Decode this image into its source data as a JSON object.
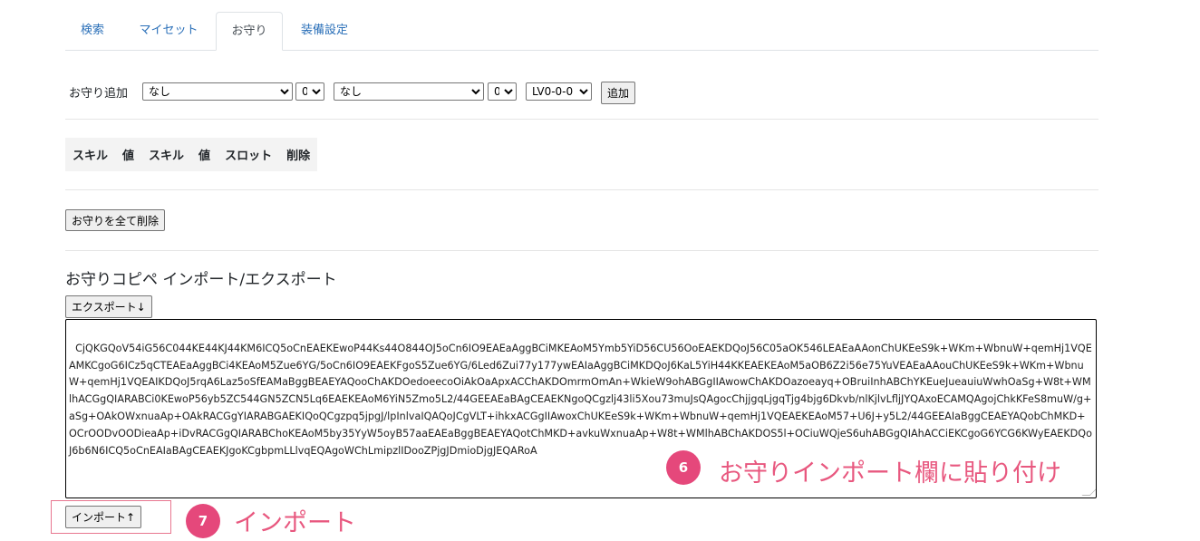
{
  "tabs": [
    {
      "label": "検索"
    },
    {
      "label": "マイセット"
    },
    {
      "label": "お守り"
    },
    {
      "label": "装備設定"
    }
  ],
  "add_row": {
    "label": "お守り追加",
    "skill1": "なし",
    "value1": "0",
    "skill2": "なし",
    "value2": "0",
    "slot": "LV0-0-0",
    "add_button": "追加"
  },
  "skill_table": {
    "headers": [
      "スキル",
      "値",
      "スキル",
      "値",
      "スロット",
      "削除"
    ]
  },
  "delete_all_button": "お守りを全て削除",
  "copy_section": {
    "title": "お守りコピペ インポート/エクスポート",
    "export_button": "エクスポート↓",
    "textarea_value": "CjQKGQoV54iG56C044KE44KJ44KM6ICQ5oCnEAEKEwoP44Ks44O844OJ5oCn6IO9EAEaAggBCiMKEAoM5Ymb5YiD56CU56OoEAEKDQoJ56C05aOK546LEAEaAAonChUKEeS9k+WKm+WbnuW+qemHj1VQEAMKCgoG6ICz5qCTEAEaAggBCi4KEAoM5Zue6YG/5oCn6IO9EAEKFgoS5Zue6YG/6Led6Zui77y177ywEAIaAggBCiMKDQoJ6KaL5YiH44KKEAEKEAoM5aOB6Z2i56e75YuVEAEaAAouChUKEeS9k+WKm+WbnuW+qemHj1VQEAIKDQoJ5rqA6Laz5oSfEAMaBggBEAEYAQooChAKDOedoeecoOiAkOaApxACChAKDOmrmOmAn+WkieW9ohABGgIIAwowChAKDOazoeayq+OBruiInhABChYKEueJueauiuWwhOaSg+W8t+WMlhACGgQIARABCi0KEwoP56yb5ZC544GN5ZCN5Lq6EAEKEAoM6YiN5Zmo5L2/44GEEAEaBAgCEAEKNgoQCgzlj43li5Xou73muJsQAgocChjjgqLjgqTjg4bjg6Dkvb/nlKjlvLfljJYQAxoECAMQAgojChkKFeS8muW/g+aSg+OAkOWxnuaAp+OAkRACGgYIARABGAEKIQoQCgzpq5jpgJ/lpInlvaIQAQoJCgVLT+ihkxACGgIIAwoxChUKEeS9k+WKm+WbnuW+qemHj1VQEAEKEAoM57+U6J+y5L2/44GEEAIaBggCEAEYAQobChMKD+OCrOODvOODieaAp+iDvRACGgQIARABChoKEAoM5by35YyW5oyB57aaEAEaBggBEAEYAQotChMKD+avkuWxnuaAp+W8t+WMlhABChAKDOS5l+OCiuWQjeS6uhABGgQIAhACCiEKCgoG6YCG6KWyEAEKDQoJ6b6N6ICQ5oCnEAIaBAgCEAEKJgoKCgbpmLLlvqEQAgoWChLmipzlIDooZPjgJDmioDjgJEQARoA"
  },
  "import_button": "インポート↑",
  "annotations": [
    {
      "number": "6",
      "text": "お守りインポート欄に貼り付け"
    },
    {
      "number": "7",
      "text": "インポート"
    }
  ]
}
